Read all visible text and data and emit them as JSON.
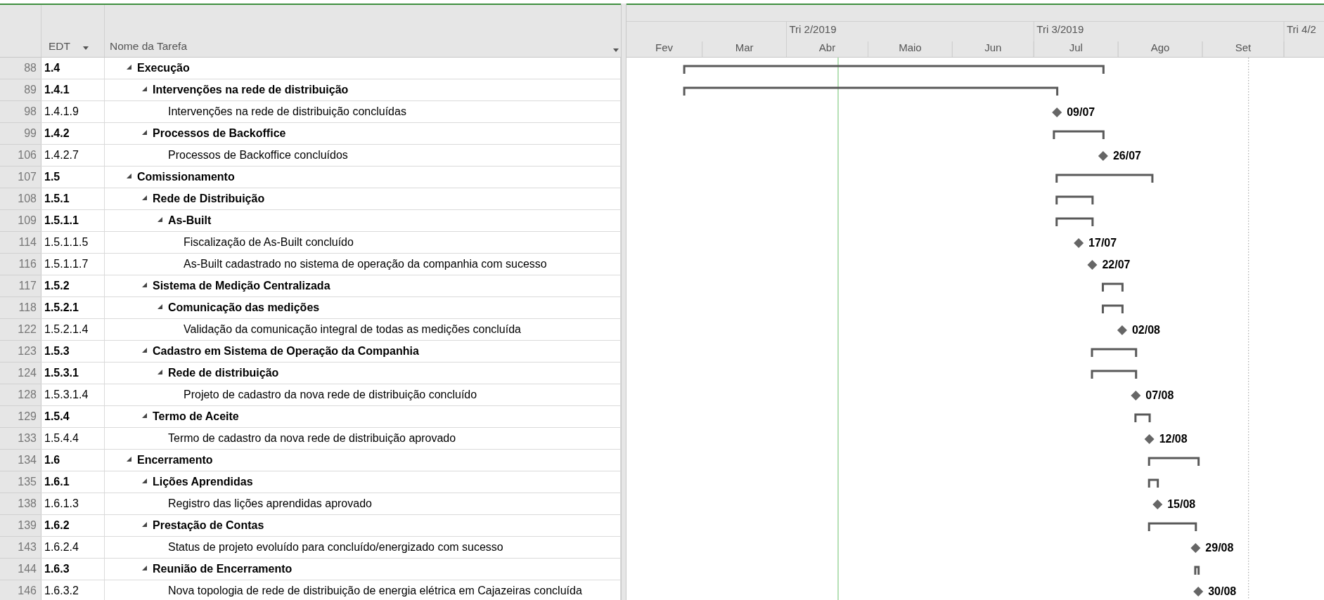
{
  "table": {
    "columns": [
      {
        "label": "EDT",
        "kind": "dropdown"
      },
      {
        "label": "Nome da Tarefa",
        "kind": "dropdown"
      }
    ],
    "tasks": [
      {
        "id": "88",
        "wbs": "1.4",
        "name": "Execução",
        "kind": "summary",
        "expanded": true,
        "children": [
          {
            "id": "89",
            "wbs": "1.4.1",
            "name": "Intervenções na rede de distribuição",
            "kind": "summary",
            "expanded": true,
            "children": [
              {
                "id": "98",
                "wbs": "1.4.1.9",
                "name": "Intervenções na rede de distribuição concluídas",
                "kind": "milestone",
                "bar_label": "09/07"
              }
            ]
          },
          {
            "id": "99",
            "wbs": "1.4.2",
            "name": "Processos de Backoffice",
            "kind": "summary",
            "expanded": true,
            "children": [
              {
                "id": "106",
                "wbs": "1.4.2.7",
                "name": "Processos de Backoffice concluídos",
                "kind": "milestone",
                "bar_label": "26/07"
              }
            ]
          }
        ]
      },
      {
        "id": "107",
        "wbs": "1.5",
        "name": "Comissionamento",
        "kind": "summary",
        "expanded": true,
        "children": [
          {
            "id": "108",
            "wbs": "1.5.1",
            "name": "Rede de Distribuição",
            "kind": "summary",
            "expanded": true,
            "children": [
              {
                "id": "109",
                "wbs": "1.5.1.1",
                "name": "As-Built",
                "kind": "summary",
                "expanded": true,
                "children": [
                  {
                    "id": "114",
                    "wbs": "1.5.1.1.5",
                    "name": "Fiscalização de As-Built concluído",
                    "kind": "milestone",
                    "bar_label": "17/07"
                  },
                  {
                    "id": "116",
                    "wbs": "1.5.1.1.7",
                    "name": "As-Built cadastrado no sistema de operação da companhia com sucesso",
                    "kind": "milestone",
                    "bar_label": "22/07"
                  }
                ]
              }
            ]
          },
          {
            "id": "117",
            "wbs": "1.5.2",
            "name": "Sistema de Medição Centralizada",
            "kind": "summary",
            "expanded": true,
            "children": [
              {
                "id": "118",
                "wbs": "1.5.2.1",
                "name": "Comunicação das medições",
                "kind": "summary",
                "expanded": true,
                "children": [
                  {
                    "id": "122",
                    "wbs": "1.5.2.1.4",
                    "name": "Validação da comunicação integral de todas as medições concluída",
                    "kind": "milestone",
                    "bar_label": "02/08"
                  }
                ]
              }
            ]
          },
          {
            "id": "123",
            "wbs": "1.5.3",
            "name": "Cadastro em Sistema de Operação da Companhia",
            "kind": "summary",
            "expanded": true,
            "children": [
              {
                "id": "124",
                "wbs": "1.5.3.1",
                "name": "Rede de distribuição",
                "kind": "summary",
                "expanded": true,
                "children": [
                  {
                    "id": "128",
                    "wbs": "1.5.3.1.4",
                    "name": "Projeto de cadastro da nova rede de distribuição concluído",
                    "kind": "milestone",
                    "bar_label": "07/08"
                  }
                ]
              }
            ]
          },
          {
            "id": "129",
            "wbs": "1.5.4",
            "name": "Termo de Aceite",
            "kind": "summary",
            "expanded": true,
            "children": [
              {
                "id": "133",
                "wbs": "1.5.4.4",
                "name": "Termo de cadastro da nova rede de distribuição aprovado",
                "kind": "milestone",
                "bar_label": "12/08"
              }
            ]
          }
        ]
      },
      {
        "id": "134",
        "wbs": "1.6",
        "name": "Encerramento",
        "kind": "summary",
        "expanded": true,
        "children": [
          {
            "id": "135",
            "wbs": "1.6.1",
            "name": "Lições Aprendidas",
            "kind": "summary",
            "expanded": true,
            "children": [
              {
                "id": "138",
                "wbs": "1.6.1.3",
                "name": "Registro das lições aprendidas aprovado",
                "kind": "milestone",
                "bar_label": "15/08"
              }
            ]
          },
          {
            "id": "139",
            "wbs": "1.6.2",
            "name": "Prestação de Contas",
            "kind": "summary",
            "expanded": true,
            "children": [
              {
                "id": "143",
                "wbs": "1.6.2.4",
                "name": "Status de projeto evoluído para concluído/energizado com sucesso",
                "kind": "milestone",
                "bar_label": "29/08"
              }
            ]
          },
          {
            "id": "144",
            "wbs": "1.6.3",
            "name": "Reunião de Encerramento",
            "kind": "summary",
            "expanded": true,
            "children": [
              {
                "id": "146",
                "wbs": "1.6.3.2",
                "name": "Nova topologia de rede de distribuição de energia elétrica em Cajazeiras concluída",
                "kind": "milestone",
                "bar_label": "30/08"
              }
            ]
          }
        ]
      }
    ]
  },
  "timescale": {
    "quarters": [
      "Tri 2/2019",
      "Tri 3/2019",
      "Tri 4/2"
    ],
    "months": [
      "Fev",
      "Mar",
      "Abr",
      "Maio",
      "Jun",
      "Jul",
      "Ago",
      "Set"
    ]
  }
}
